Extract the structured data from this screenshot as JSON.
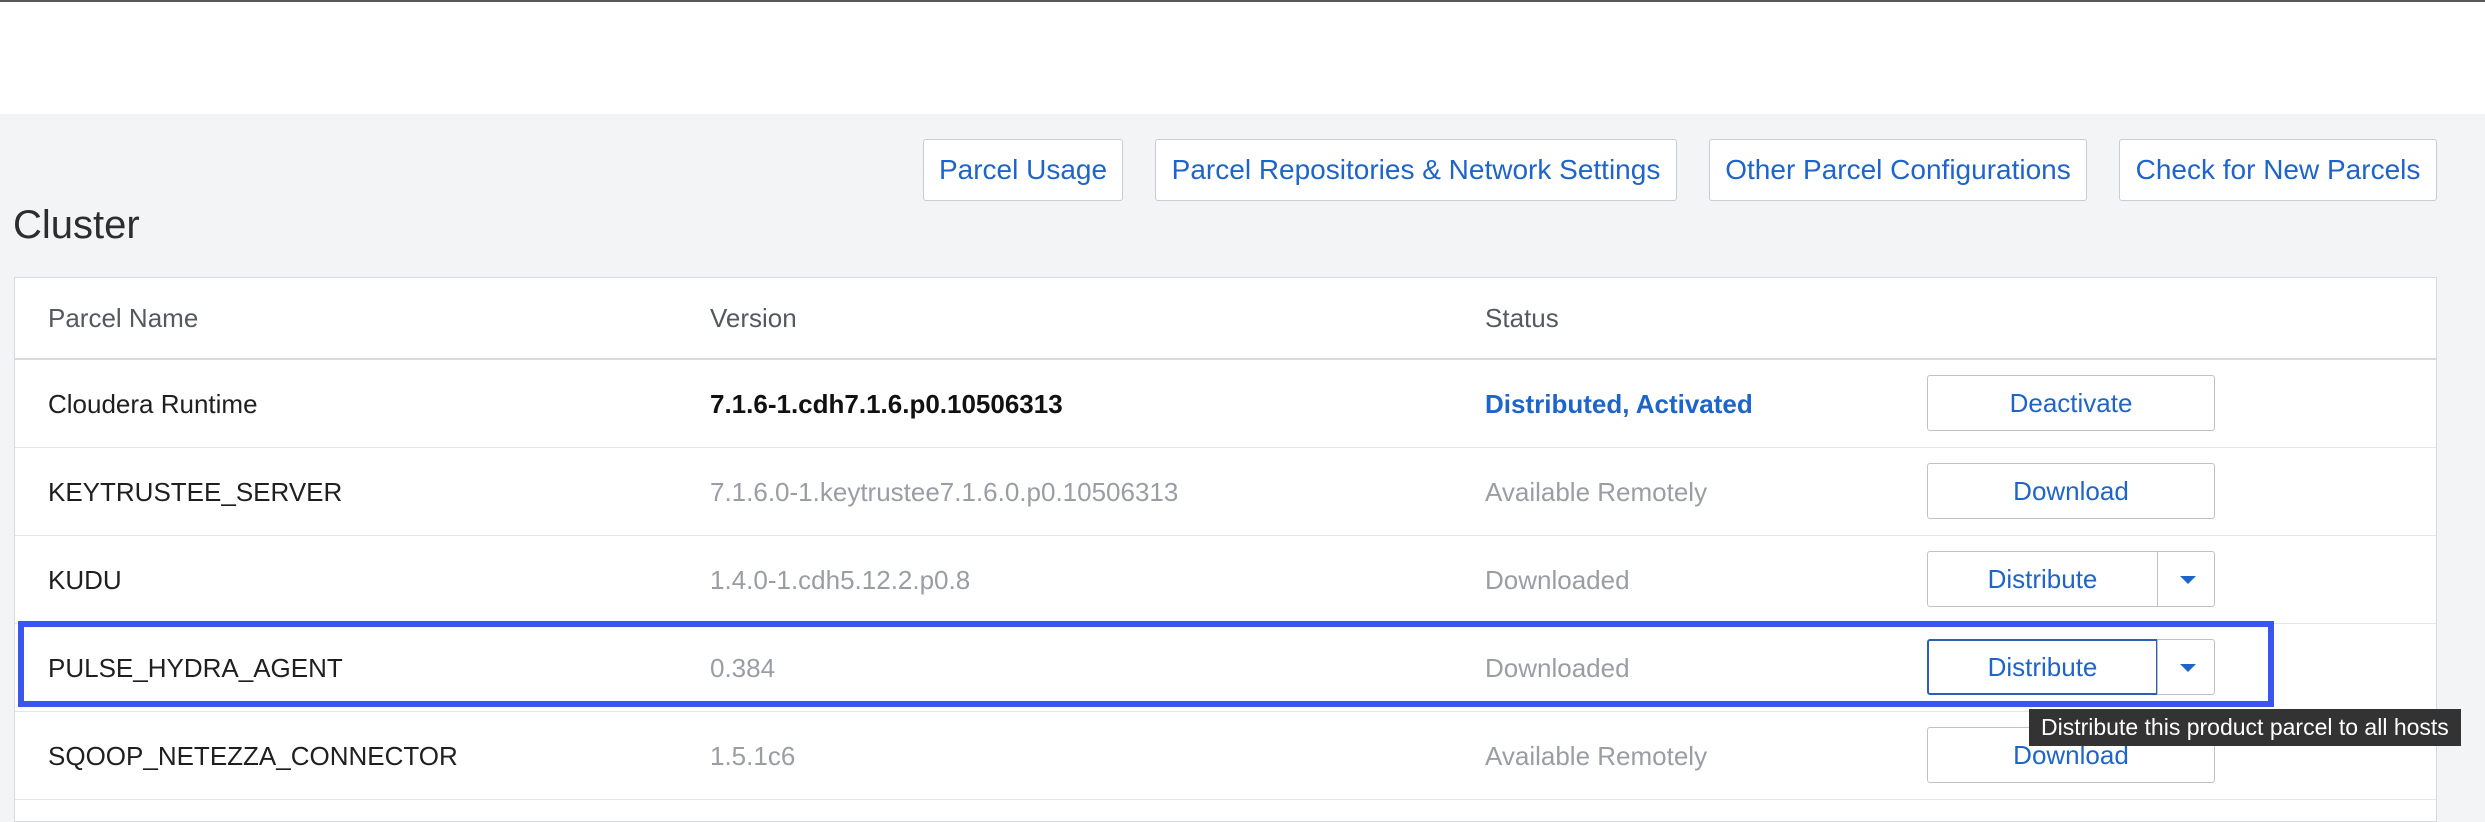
{
  "toolbar": {
    "parcel_usage": "Parcel Usage",
    "parcel_repositories": "Parcel Repositories & Network Settings",
    "other_configs": "Other Parcel Configurations",
    "check_new": "Check for New Parcels"
  },
  "section_title": "Cluster",
  "table": {
    "headers": [
      "Parcel Name",
      "Version",
      "Status"
    ],
    "rows": [
      {
        "name": "Cloudera Runtime",
        "version": "7.1.6-1.cdh7.1.6.p0.10506313",
        "status": "Distributed, Activated",
        "action": "Deactivate"
      },
      {
        "name": "KEYTRUSTEE_SERVER",
        "version": "7.1.6.0-1.keytrustee7.1.6.0.p0.10506313",
        "status": "Available Remotely",
        "action": "Download"
      },
      {
        "name": "KUDU",
        "version": "1.4.0-1.cdh5.12.2.p0.8",
        "status": "Downloaded",
        "action": "Distribute"
      },
      {
        "name": "PULSE_HYDRA_AGENT",
        "version": "0.384",
        "status": "Downloaded",
        "action": "Distribute"
      },
      {
        "name": "SQOOP_NETEZZA_CONNECTOR",
        "version": "1.5.1c6",
        "status": "Available Remotely",
        "action": "Download"
      }
    ]
  },
  "tooltip": "Distribute this product parcel to all hosts",
  "colors": {
    "link": "#1f64c8",
    "highlight": "#3b56f0",
    "background": "#f3f4f6"
  },
  "icons": {
    "dropdown": "caret-down-icon"
  }
}
